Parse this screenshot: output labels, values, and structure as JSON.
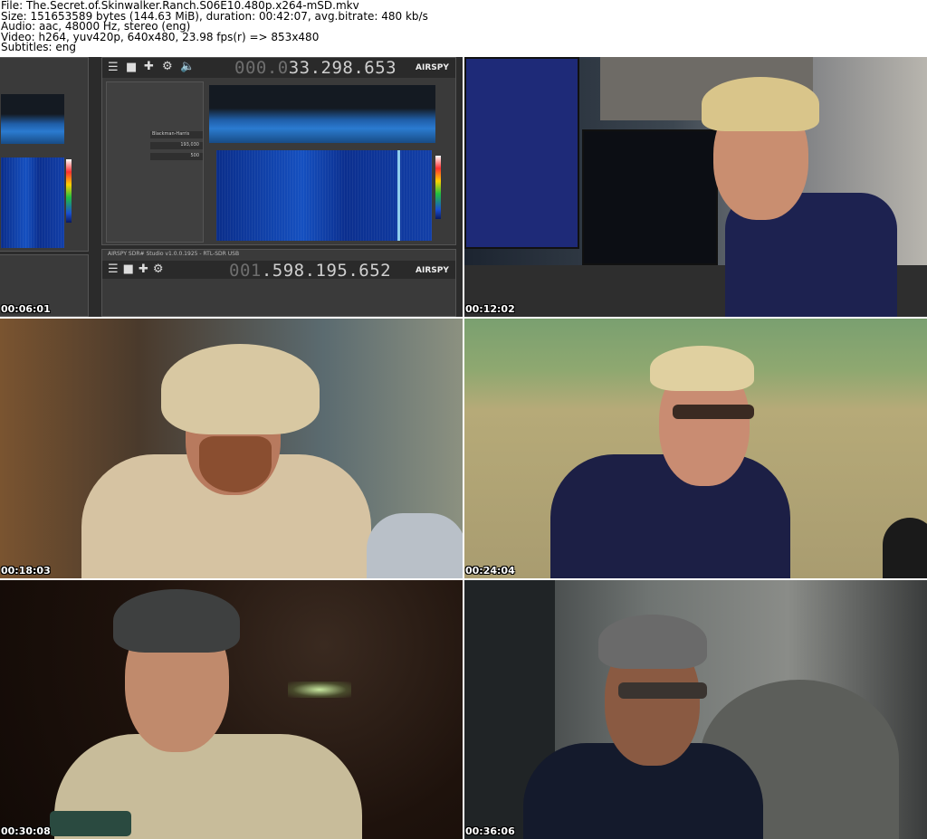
{
  "header": {
    "file": "File: The.Secret.of.Skinwalker.Ranch.S06E10.480p.x264-mSD.mkv",
    "size": "Size: 151653589 bytes (144.63 MiB), duration: 00:42:07, avg.bitrate: 480 kb/s",
    "audio": "Audio: aac, 48000 Hz, stereo (eng)",
    "video": "Video: h264, yuv420p, 640x480, 23.98 fps(r) => 853x480",
    "subtitles": "Subtitles: eng"
  },
  "thumbnails": [
    {
      "timestamp": "00:06:01"
    },
    {
      "timestamp": "00:12:02"
    },
    {
      "timestamp": "00:18:03"
    },
    {
      "timestamp": "00:24:04"
    },
    {
      "timestamp": "00:30:08"
    },
    {
      "timestamp": "00:36:06"
    }
  ],
  "sdr": {
    "freq_top_dim": "000.0",
    "freq_top": "33.298.653",
    "freq_bottom_dim": "001",
    "freq_bottom": ".598.195.652",
    "brand": "AIRSPY",
    "window_title": "AIRSPY SDR# Studio v1.0.0.1925 - RTL-SDR USB",
    "filter": "Blackman-Harris",
    "bandwidth": "193,030",
    "order": "500"
  },
  "colors": {
    "background": "#ffffff",
    "timestamp_text": "#ffffff"
  }
}
